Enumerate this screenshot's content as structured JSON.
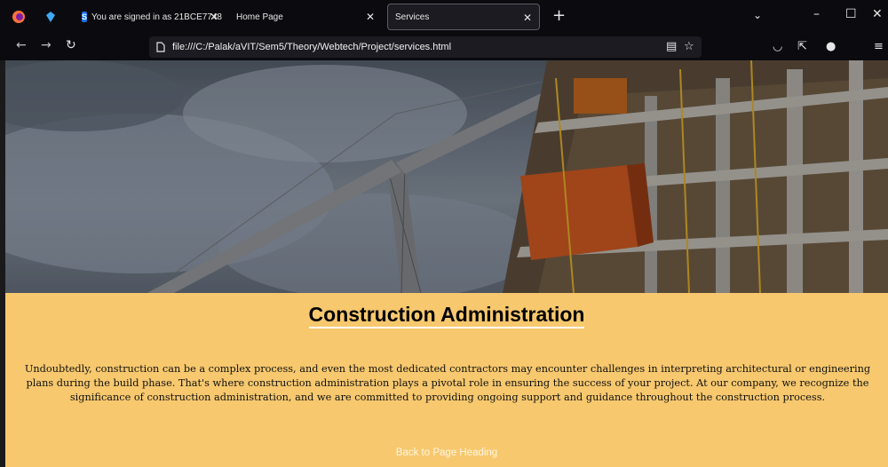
{
  "browser": {
    "tabs": [
      {
        "label": "You are signed in as 21BCE7748",
        "favicon": "S",
        "close": "✕",
        "active": false
      },
      {
        "label": "Home Page",
        "close": "✕",
        "active": false
      },
      {
        "label": "Services",
        "close": "✕",
        "active": true
      }
    ],
    "new_tab": "+",
    "url": "file:///C:/Palak/aVIT/Sem5/Theory/Webtech/Project/services.html"
  },
  "page": {
    "heading": "Construction Administration",
    "paragraph": "Undoubtedly, construction can be a complex process, and even the most dedicated contractors may encounter challenges in interpreting architectural or engineering plans during the build phase. That's where construction administration plays a pivotal role in ensuring the success of your project. At our company, we recognize the significance of construction administration, and we are committed to providing ongoing support and guidance throughout the construction process.",
    "back_link": "Back to Page Heading"
  },
  "colors": {
    "section_bg": "#f7c86e",
    "chrome_bg": "#0b0b0f",
    "urlbar_bg": "#1c1b22"
  }
}
